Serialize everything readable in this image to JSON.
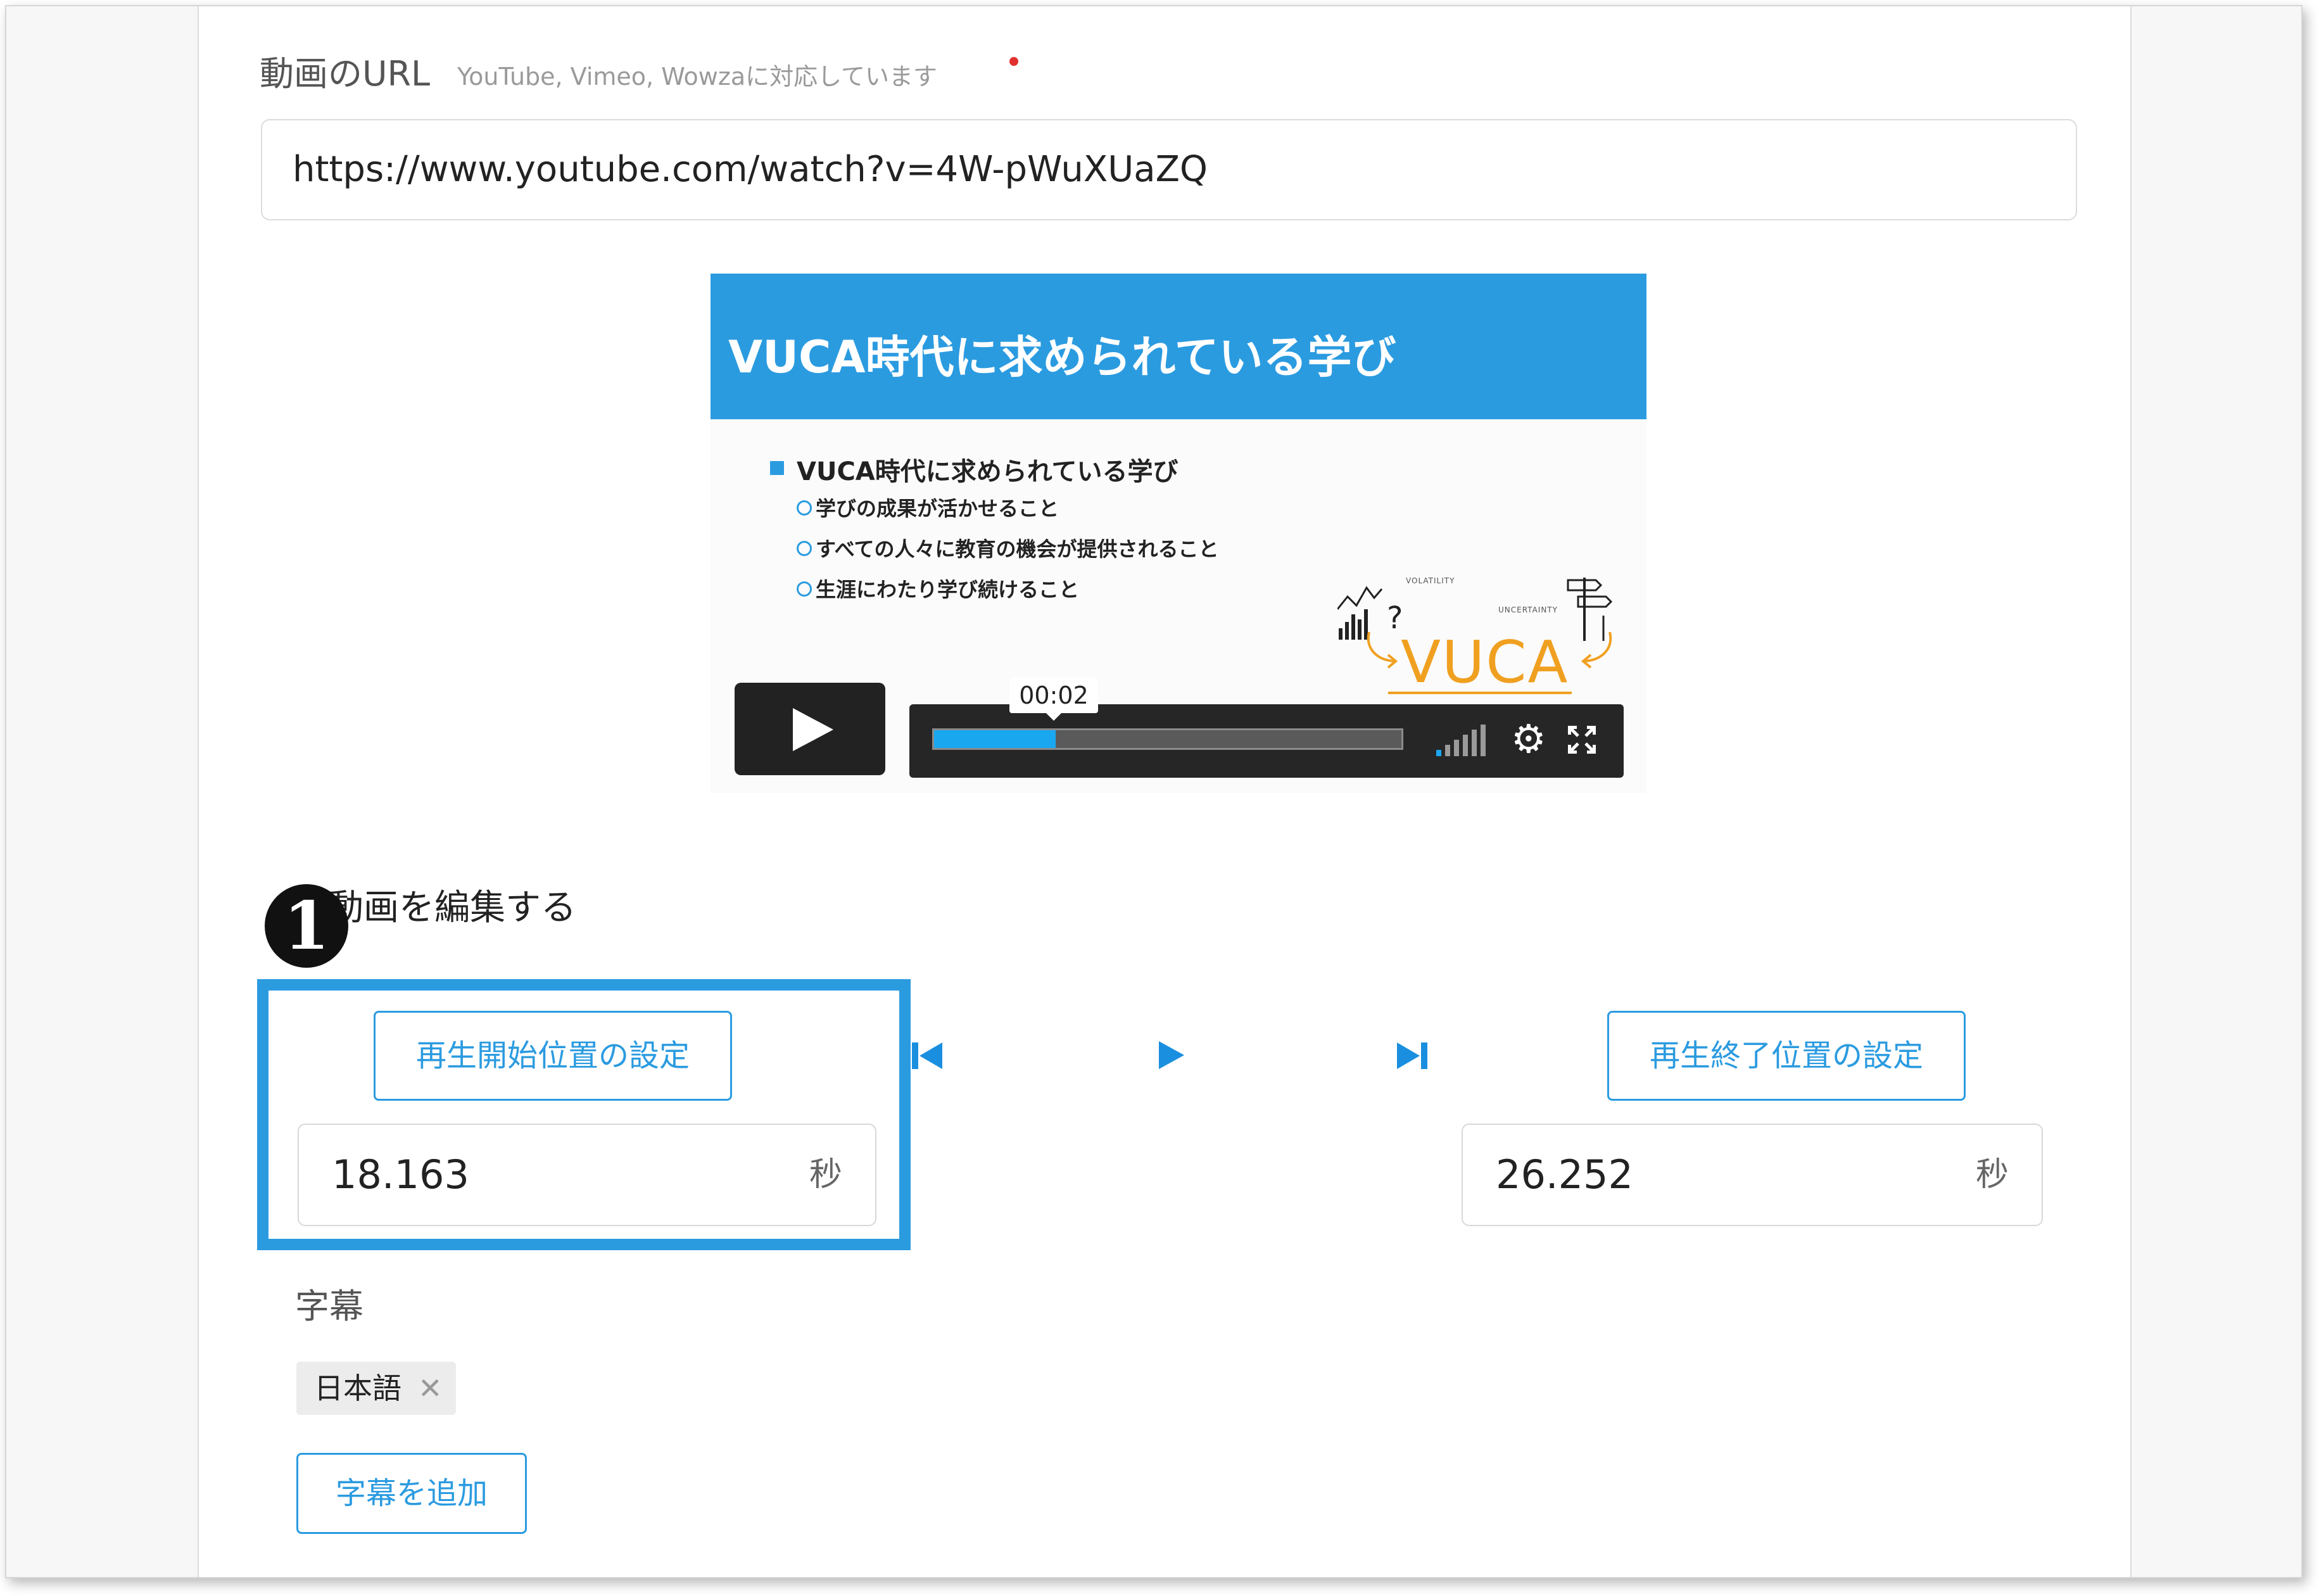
{
  "form": {
    "url_label": "動画のURL",
    "url_hint": "YouTube, Vimeo, Wowzaに対応しています",
    "url_value": "https://www.youtube.com/watch?v=4W-pWuXUaZQ"
  },
  "video": {
    "slide_title": "VUCA時代に求められている学び",
    "slide_bullet": "VUCA時代に求められている学び",
    "slide_subitems": [
      "学びの成果が活かせること",
      "すべての人々に教育の機会が提供されること",
      "生涯にわたり学び続けること"
    ],
    "logo_text": "VUCA",
    "logo_words": [
      "VOLATILITY",
      "UNCERTAINTY"
    ],
    "current_time": "00:02",
    "progress": 0.26,
    "icons": {
      "play": "play-icon",
      "settings": "gear-icon",
      "fullscreen": "fullscreen-icon",
      "volume": "volume-icon"
    }
  },
  "edit": {
    "badge": "1",
    "title": "動画を編集する",
    "start_button": "再生開始位置の設定",
    "end_button": "再生終了位置の設定",
    "start_value": "18.163",
    "end_value": "26.252",
    "unit": "秒",
    "icons": {
      "prev": "skip-to-start-icon",
      "play": "play-icon",
      "next": "skip-to-end-icon"
    }
  },
  "subtitles": {
    "label": "字幕",
    "tags": [
      "日本語"
    ],
    "remove_symbol": "✕",
    "add_button": "字幕を追加"
  },
  "colors": {
    "accent": "#2b9be0",
    "required": "#e0312f",
    "progress": "#19a8f0",
    "logo": "#f0a020"
  }
}
